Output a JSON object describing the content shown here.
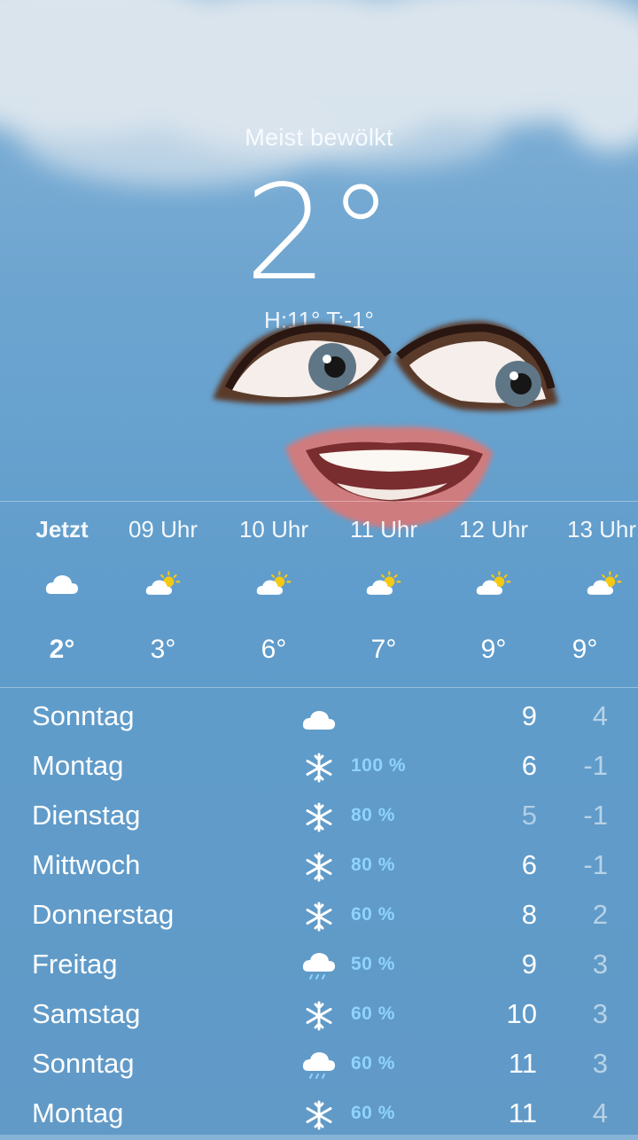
{
  "current": {
    "condition": "Meist bewölkt",
    "temperature": "2°",
    "hi_lo": "H:11° T:-1°"
  },
  "colors": {
    "sky_top": "#86b2d6",
    "sky_bottom": "#619ac7",
    "precip_blue": "#8fd3ff",
    "sun_yellow": "#f5c814"
  },
  "hourly": [
    {
      "time": "Jetzt",
      "icon": "cloud-icon",
      "temp": "2°"
    },
    {
      "time": "09 Uhr",
      "icon": "partly-sunny-icon",
      "temp": "3°"
    },
    {
      "time": "10 Uhr",
      "icon": "partly-sunny-icon",
      "temp": "6°"
    },
    {
      "time": "11 Uhr",
      "icon": "partly-sunny-icon",
      "temp": "7°"
    },
    {
      "time": "12 Uhr",
      "icon": "partly-sunny-icon",
      "temp": "9°"
    },
    {
      "time": "13 Uhr",
      "icon": "partly-sunny-icon",
      "temp": "9°"
    }
  ],
  "daily": [
    {
      "day": "Sonntag",
      "icon": "cloud-icon",
      "prob": "",
      "high": "9",
      "low": "4"
    },
    {
      "day": "Montag",
      "icon": "snowflake-icon",
      "prob": "100 %",
      "high": "6",
      "low": "-1"
    },
    {
      "day": "Dienstag",
      "icon": "snowflake-icon",
      "prob": "80 %",
      "high": "5",
      "low": "-1"
    },
    {
      "day": "Mittwoch",
      "icon": "snowflake-icon",
      "prob": "80 %",
      "high": "6",
      "low": "-1"
    },
    {
      "day": "Donnerstag",
      "icon": "snowflake-icon",
      "prob": "60 %",
      "high": "8",
      "low": "2"
    },
    {
      "day": "Freitag",
      "icon": "rain-cloud-icon",
      "prob": "50 %",
      "high": "9",
      "low": "3"
    },
    {
      "day": "Samstag",
      "icon": "snowflake-icon",
      "prob": "60 %",
      "high": "10",
      "low": "3"
    },
    {
      "day": "Sonntag",
      "icon": "rain-cloud-icon",
      "prob": "60 %",
      "high": "11",
      "low": "3"
    },
    {
      "day": "Montag",
      "icon": "snowflake-icon",
      "prob": "60 %",
      "high": "11",
      "low": "4"
    }
  ]
}
